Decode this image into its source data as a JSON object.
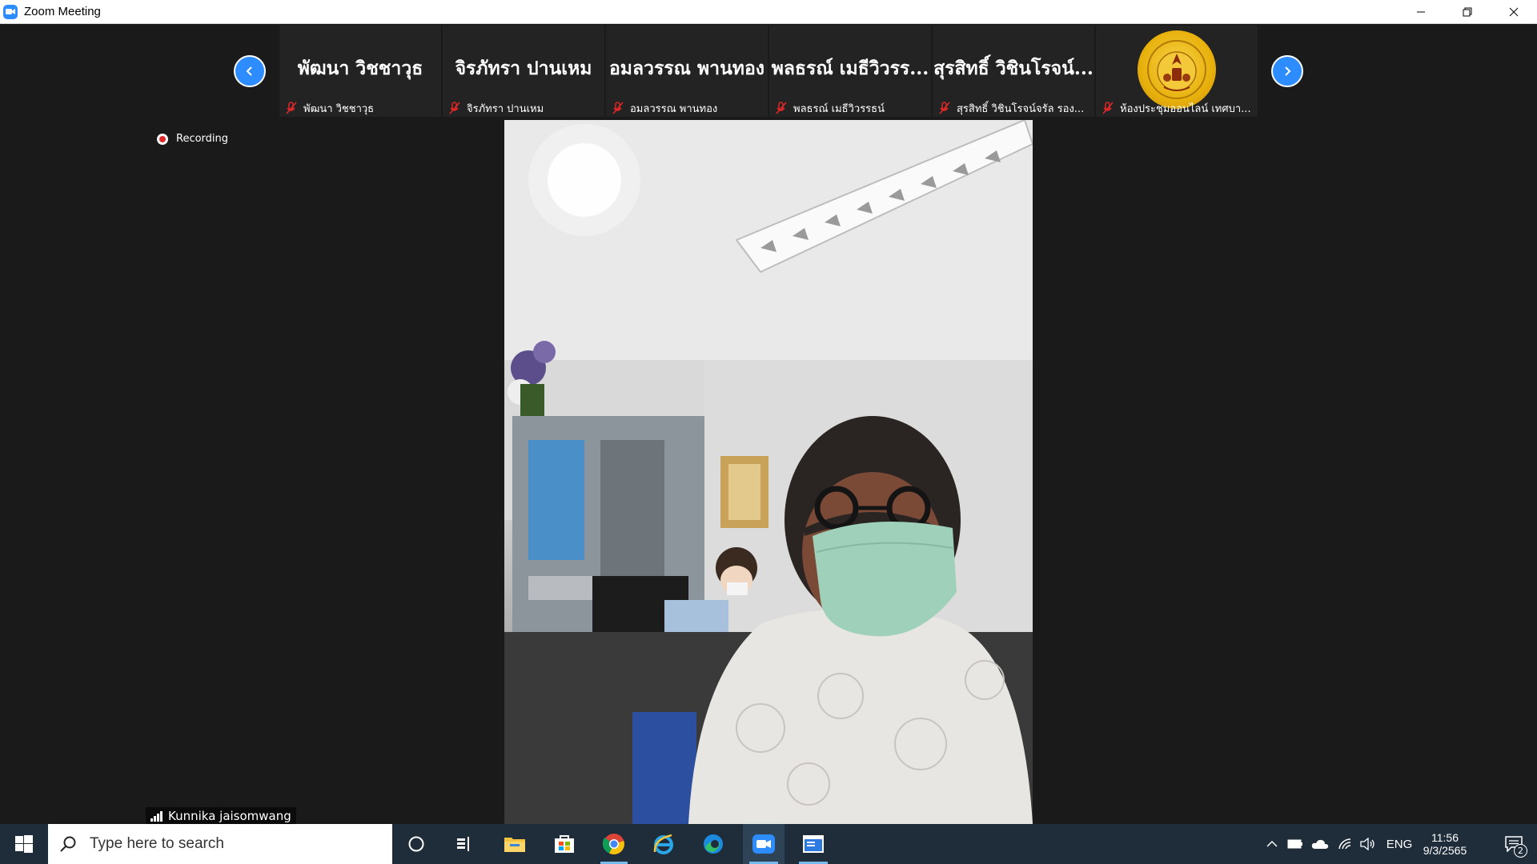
{
  "window": {
    "title": "Zoom Meeting",
    "icon": "zoom-camera-icon"
  },
  "gallery": {
    "tiles": [
      {
        "display_name": "พัฒนา วิชชาวุธ",
        "label": "พัฒนา วิชชาวุธ",
        "muted": true
      },
      {
        "display_name": "จิรภัทรา ปานเหม",
        "label": "จิรภัทรา ปานเหม",
        "muted": true
      },
      {
        "display_name": "อมลวรรณ พานทอง",
        "label": "อมลวรรณ พานทอง",
        "muted": true
      },
      {
        "display_name": "พลธรณ์ เมธีวิวรร...",
        "label": "พลธรณ์ เมธีวิวรรธน์",
        "muted": true
      },
      {
        "display_name": "สุรสิทธิ์ วิชินโรจน์...",
        "label": "สุรสิทธิ์ วิชินโรจน์จรัล รอง...",
        "muted": true
      },
      {
        "display_name": "",
        "label": "ห้องประชุมออนไลน์ เทศบา...",
        "muted": true,
        "avatar": "municipal-seal-logo"
      }
    ]
  },
  "recording": {
    "label": "Recording"
  },
  "active_speaker": {
    "name": "Kunnika jaisomwang"
  },
  "taskbar": {
    "search_placeholder": "Type here to search",
    "apps": [
      "cortana-icon",
      "task-view-icon",
      "file-explorer-icon",
      "store-icon",
      "chrome-icon",
      "internet-explorer-icon",
      "edge-icon",
      "zoom-icon",
      "window-icon"
    ],
    "language": "ENG",
    "time": "11:56",
    "date": "9/3/2565",
    "notifications": "2"
  },
  "colors": {
    "accent": "#2d8cff",
    "mute": "#e02828",
    "taskbar": "#1f2c3a"
  }
}
